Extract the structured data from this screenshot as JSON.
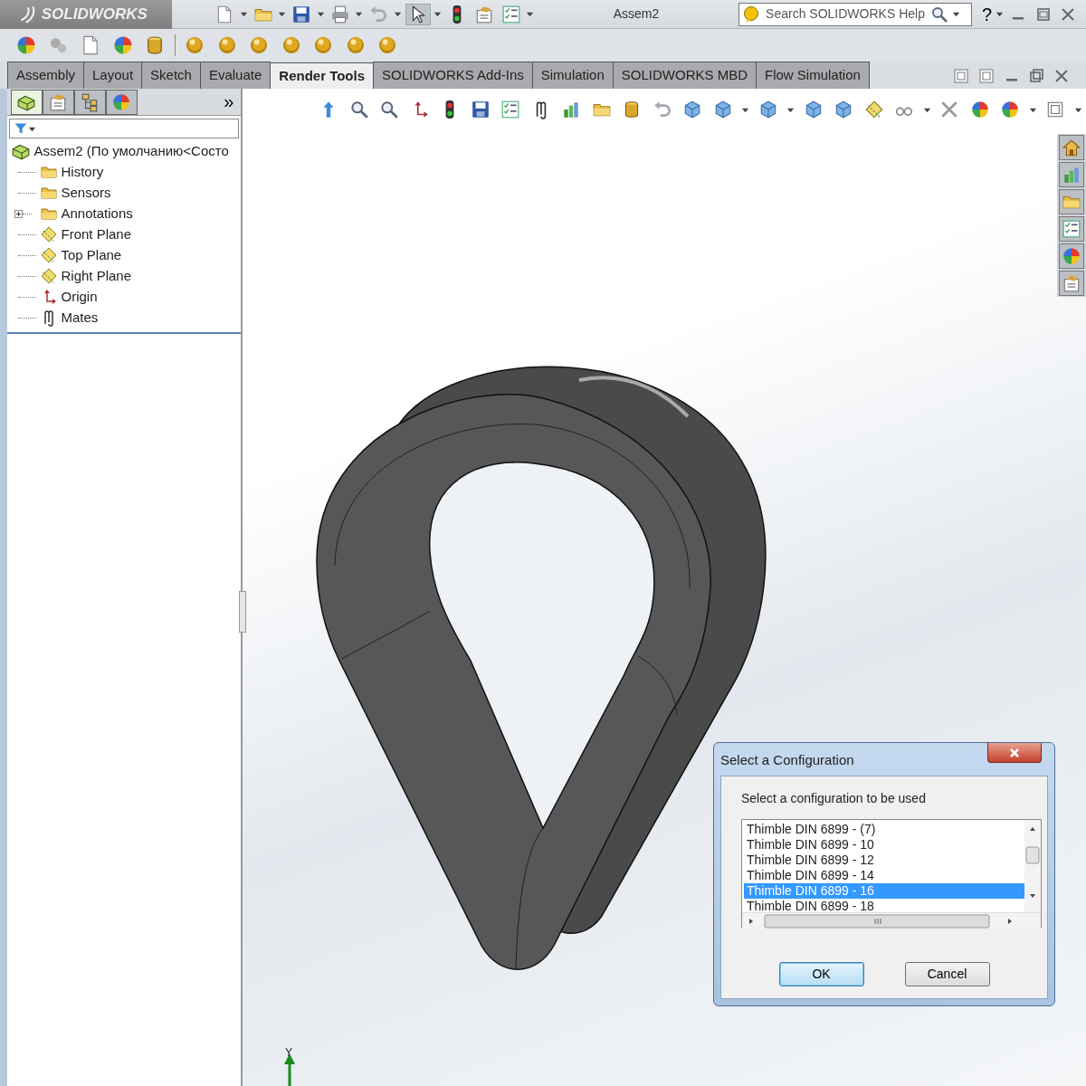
{
  "app": {
    "logo": "SOLIDWORKS",
    "title": "Assem2",
    "search": {
      "placeholder": "Search SOLIDWORKS Help"
    },
    "help_button": "?"
  },
  "tabs": [
    {
      "label": "Assembly",
      "selected": false
    },
    {
      "label": "Layout",
      "selected": false
    },
    {
      "label": "Sketch",
      "selected": false
    },
    {
      "label": "Evaluate",
      "selected": false
    },
    {
      "label": "Render Tools",
      "selected": true
    },
    {
      "label": "SOLIDWORKS Add-Ins",
      "selected": false
    },
    {
      "label": "Simulation",
      "selected": false
    },
    {
      "label": "SOLIDWORKS MBD",
      "selected": false
    },
    {
      "label": "Flow Simulation",
      "selected": false
    }
  ],
  "panel": {
    "expand_button": "»",
    "tree": {
      "label": "Assem2  (По умолчанию<Состо",
      "children": [
        {
          "label": "History",
          "collapsed": false
        },
        {
          "label": "Sensors",
          "collapsed": false
        },
        {
          "label": "Annotations",
          "collapsed": true
        },
        {
          "label": "Front Plane",
          "collapsed": false
        },
        {
          "label": "Top Plane",
          "collapsed": false
        },
        {
          "label": "Right Plane",
          "collapsed": false
        },
        {
          "label": "Origin",
          "collapsed": false
        },
        {
          "label": "Mates",
          "collapsed": false
        }
      ]
    }
  },
  "viewport": {
    "triad_label": "Y"
  },
  "dialog": {
    "title": "Select a Configuration",
    "prompt": "Select a configuration to be used",
    "items": [
      {
        "label": "Thimble DIN 6899 - (7)",
        "selected": false
      },
      {
        "label": "Thimble DIN 6899 - 10",
        "selected": false
      },
      {
        "label": "Thimble DIN 6899 - 12",
        "selected": false
      },
      {
        "label": "Thimble DIN 6899 - 14",
        "selected": false
      },
      {
        "label": "Thimble DIN 6899 - 16",
        "selected": true
      },
      {
        "label": "Thimble DIN 6899 - 18",
        "selected": false
      }
    ],
    "buttons": [
      {
        "label": "OK",
        "default": true
      },
      {
        "label": "Cancel",
        "default": false
      }
    ]
  }
}
